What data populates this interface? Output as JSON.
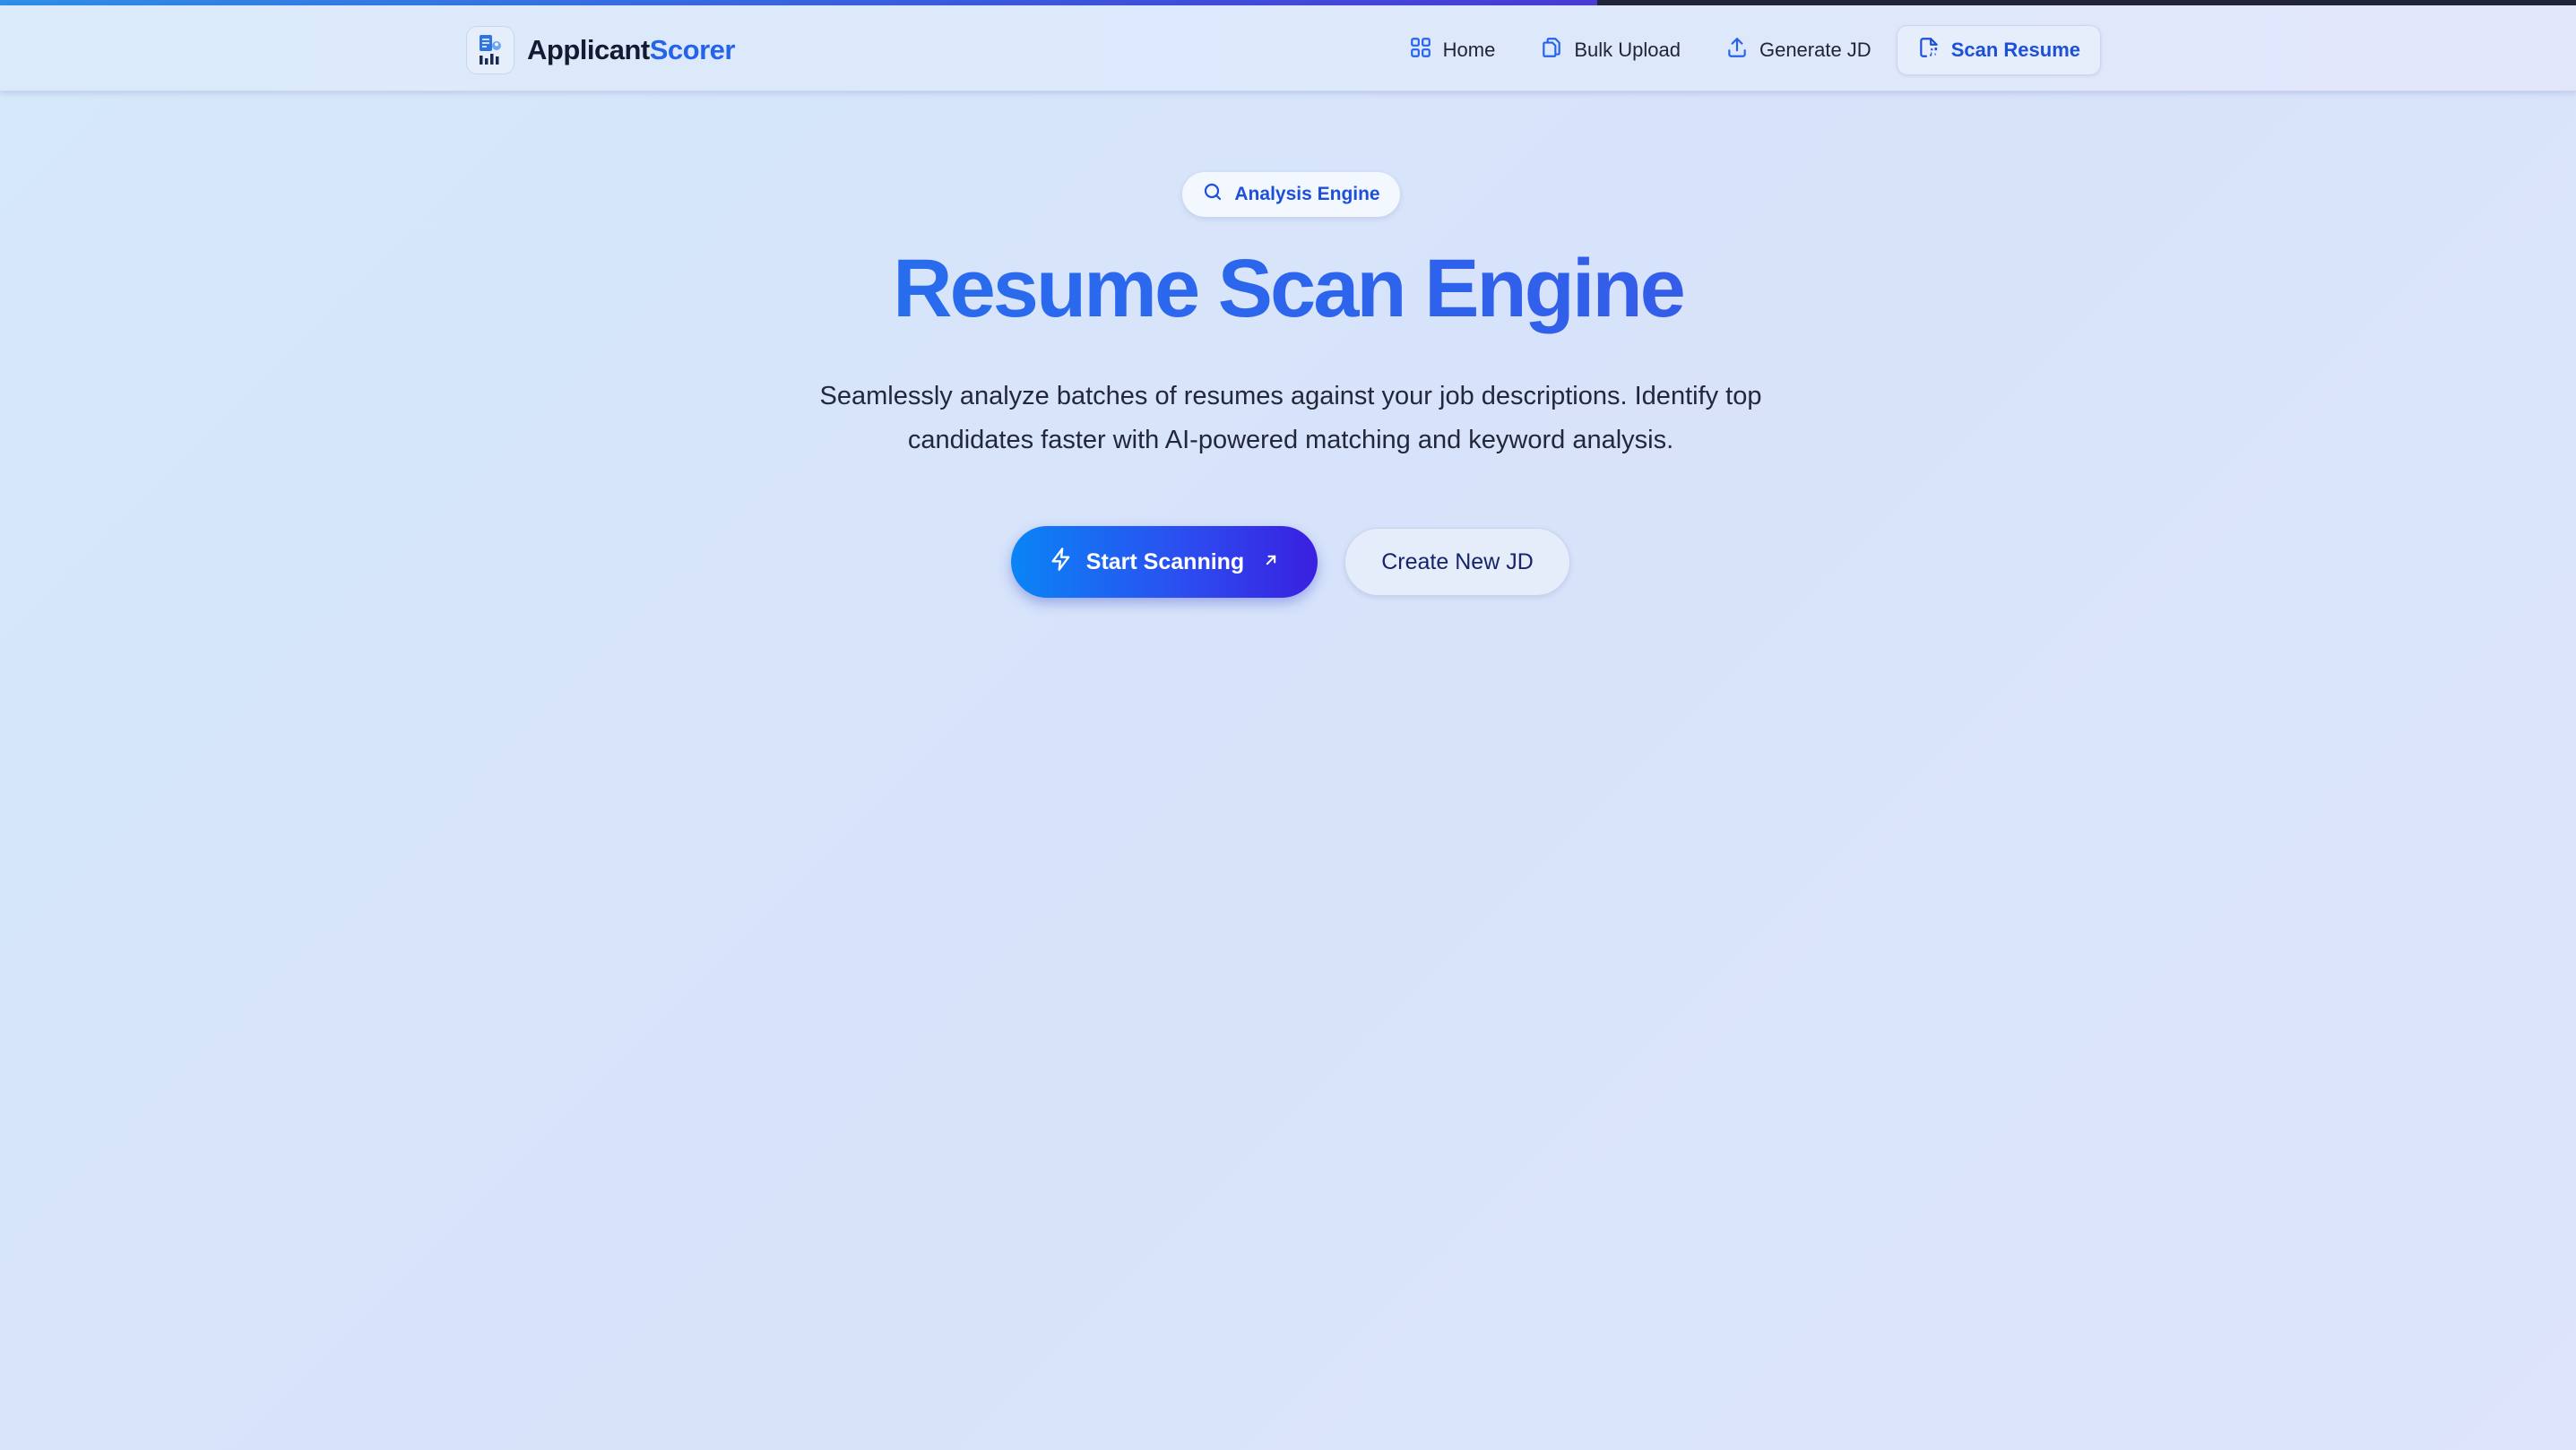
{
  "scroll_progress": 0.62,
  "colors": {
    "accent": "#2563eb",
    "primary_gradient_start": "#0a84f5",
    "primary_gradient_end": "#3a1fe0",
    "brand_dark": "#151a33"
  },
  "header": {
    "brand": {
      "name_part1": "Applicant",
      "name_part2": "Scorer",
      "logo_icon": "resume-chart-icon"
    },
    "nav": [
      {
        "label": "Home",
        "icon": "grid-icon",
        "active": false
      },
      {
        "label": "Bulk Upload",
        "icon": "files-icon",
        "active": false
      },
      {
        "label": "Generate JD",
        "icon": "upload-icon",
        "active": false
      },
      {
        "label": "Scan Resume",
        "icon": "file-scan-icon",
        "active": true
      }
    ]
  },
  "hero": {
    "badge": {
      "label": "Analysis Engine",
      "icon": "search-icon"
    },
    "title": "Resume Scan Engine",
    "subtitle": "Seamlessly analyze batches of resumes against your job descriptions. Identify top candidates faster with AI-powered matching and keyword analysis.",
    "primary_button": {
      "label": "Start Scanning",
      "icon": "lightning-icon",
      "trailing_icon": "arrow-up-right-icon"
    },
    "secondary_button": {
      "label": "Create New JD"
    }
  }
}
